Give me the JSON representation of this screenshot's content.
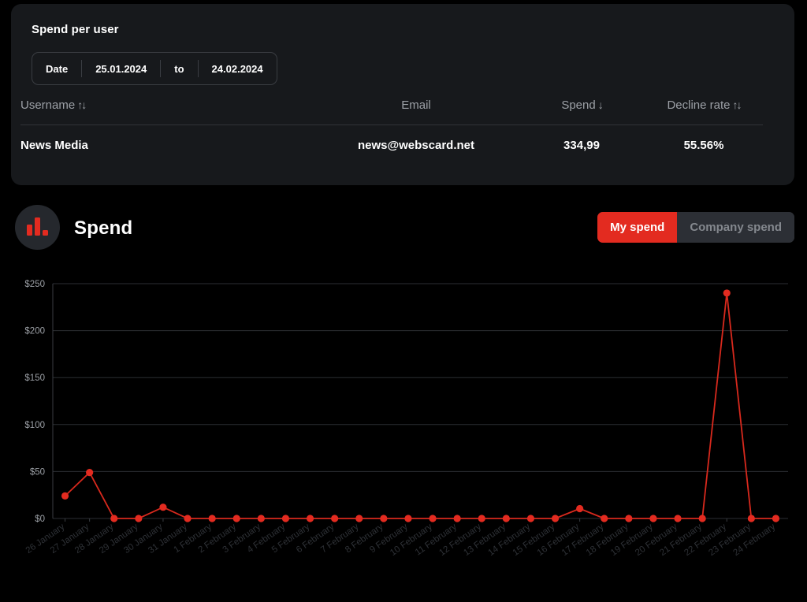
{
  "card": {
    "title": "Spend per user",
    "datepicker": {
      "label": "Date",
      "from": "25.01.2024",
      "separator": "to",
      "to": "24.02.2024"
    },
    "table": {
      "headers": [
        {
          "label": "Username",
          "sort": "↑↓"
        },
        {
          "label": "Email",
          "sort": "↑↓"
        },
        {
          "label": "Spend",
          "sort": "↓"
        },
        {
          "label": "Decline rate",
          "sort": "↑↓"
        }
      ],
      "rows": [
        {
          "username": "News Media",
          "email": "news@webscard.net",
          "spend": "334,99",
          "decline_rate": "55.56%"
        }
      ]
    }
  },
  "chart_panel": {
    "icon": "bar-chart-icon",
    "title": "Spend",
    "toggle": {
      "active": "My spend",
      "inactive": "Company spend"
    }
  },
  "colors": {
    "accent": "#e32b20",
    "line": "#d8291d",
    "panel": "#17191c",
    "background": "#000000",
    "grid": "#2b2e33",
    "muted_text": "#9ca0a6"
  },
  "chart_data": {
    "type": "line",
    "title": "Spend",
    "xlabel": "",
    "ylabel": "",
    "ylim": [
      0,
      250
    ],
    "yticks": [
      0,
      50,
      100,
      150,
      200,
      250
    ],
    "ytick_labels": [
      "$0",
      "$50",
      "$100",
      "$150",
      "$200",
      "$250"
    ],
    "grid": true,
    "legend": false,
    "series_name": "My spend",
    "categories": [
      "26 January",
      "27 January",
      "28 January",
      "29 January",
      "30 January",
      "31 January",
      "1 February",
      "2 February",
      "3 February",
      "4 February",
      "5 February",
      "6 February",
      "7 February",
      "8 February",
      "9 February",
      "10 February",
      "11 February",
      "12 February",
      "13 February",
      "14 February",
      "15 February",
      "16 February",
      "17 February",
      "18 February",
      "19 February",
      "20 February",
      "21 February",
      "22 February",
      "23 February",
      "24 February"
    ],
    "values": [
      24,
      49,
      0,
      0,
      12,
      0,
      0,
      0,
      0,
      0,
      0,
      0,
      0,
      0,
      0,
      0,
      0,
      0,
      0,
      0,
      0,
      10.5,
      0,
      0,
      0,
      0,
      0,
      240,
      0,
      0
    ]
  }
}
